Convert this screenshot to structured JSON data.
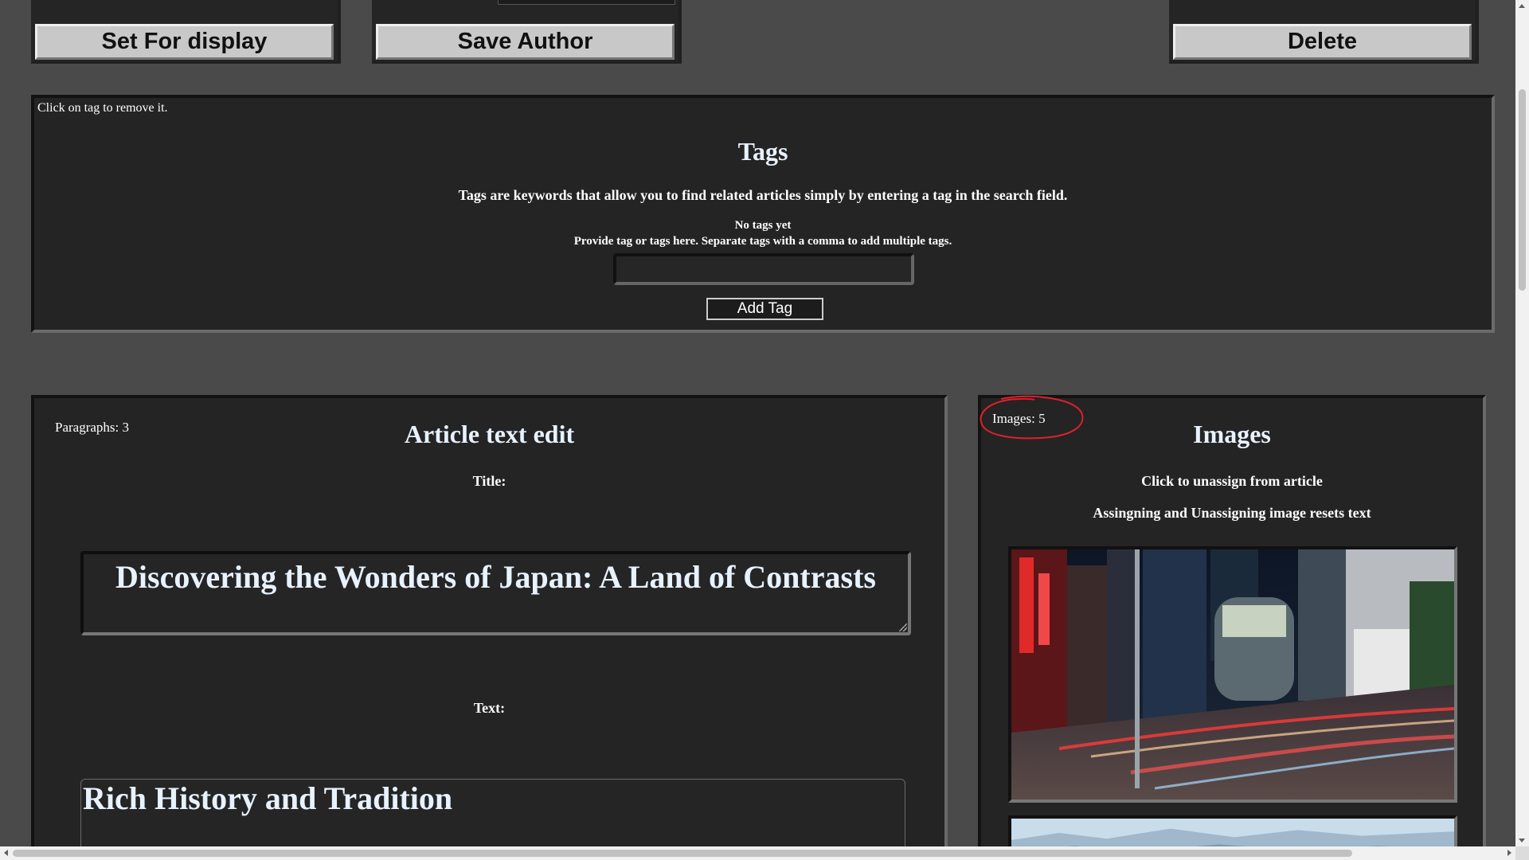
{
  "actions": {
    "set_for_display": "Set For display",
    "save_author": "Save Author",
    "delete": "Delete"
  },
  "tags": {
    "hint": "Click on tag to remove it.",
    "title": "Tags",
    "description": "Tags are keywords that allow you to find related articles simply by entering a tag in the search field.",
    "empty": "No tags yet",
    "instruction": "Provide tag or tags here. Separate tags with a comma to add multiple tags.",
    "input_value": "",
    "add_button": "Add Tag"
  },
  "article": {
    "paragraph_count": "Paragraphs: 3",
    "heading": "Article text edit",
    "title_label": "Title:",
    "title_value": "Discovering the Wonders of Japan: A Land of Contrasts",
    "text_label": "Text:",
    "text_heading": "Rich History and Tradition"
  },
  "images": {
    "count": "Images: 5",
    "heading": "Images",
    "unassign_hint": "Click to unassign from article",
    "reset_hint": "Assingning and Unassigning image resets text",
    "thumbnails": [
      {
        "icon": "city-night-street-photo"
      },
      {
        "icon": "mountain-landscape-photo"
      }
    ]
  },
  "colors": {
    "page_bg": "#4a4a4a",
    "panel_bg": "#242424",
    "heading_text": "#e8f2ff",
    "annotation": "#e0202a"
  }
}
